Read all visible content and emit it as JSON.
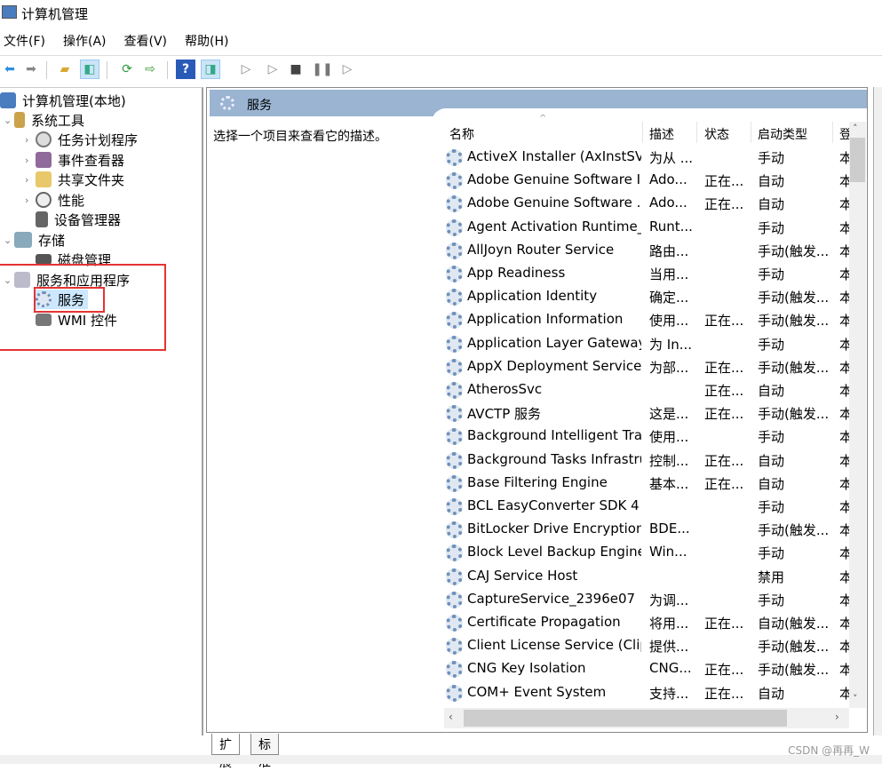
{
  "window": {
    "title": "计算机管理"
  },
  "menu": [
    "文件(F)",
    "操作(A)",
    "查看(V)",
    "帮助(H)"
  ],
  "toolbar": [
    "back-icon",
    "forward-icon",
    "up-folder-icon",
    "show-hide-tree-icon",
    "refresh-icon",
    "export-list-icon",
    "help-icon",
    "show-hide-action-pane-icon",
    "start-service-icon",
    "start-service-alt-icon",
    "stop-service-icon",
    "pause-service-icon",
    "resume-service-icon"
  ],
  "tree": [
    {
      "label": "计算机管理(本地)",
      "level": 0,
      "chev": ""
    },
    {
      "label": "系统工具",
      "level": 1,
      "chev": "⌄"
    },
    {
      "label": "任务计划程序",
      "level": 2,
      "chev": "›"
    },
    {
      "label": "事件查看器",
      "level": 2,
      "chev": "›"
    },
    {
      "label": "共享文件夹",
      "level": 2,
      "chev": "›"
    },
    {
      "label": "性能",
      "level": 2,
      "chev": "›"
    },
    {
      "label": "设备管理器",
      "level": 2,
      "chev": ""
    },
    {
      "label": "存储",
      "level": 1,
      "chev": "⌄"
    },
    {
      "label": "磁盘管理",
      "level": 2,
      "chev": ""
    },
    {
      "label": "服务和应用程序",
      "level": 1,
      "chev": "⌄"
    },
    {
      "label": "服务",
      "level": 2,
      "chev": "",
      "selected": true
    },
    {
      "label": "WMI 控件",
      "level": 2,
      "chev": ""
    }
  ],
  "pane": {
    "header": "服务",
    "description": "选择一个项目来查看它的描述。",
    "sort_indicator": "^"
  },
  "columns": [
    "名称",
    "描述",
    "状态",
    "启动类型",
    "登"
  ],
  "services": [
    [
      "ActiveX Installer (AxInstSV)",
      "为从 ...",
      "",
      "手动",
      "本"
    ],
    [
      "Adobe Genuine Software I...",
      "Ado...",
      "正在...",
      "自动",
      "本"
    ],
    [
      "Adobe Genuine Software ...",
      "Ado...",
      "正在...",
      "自动",
      "本"
    ],
    [
      "Agent Activation Runtime_...",
      "Runt...",
      "",
      "手动",
      "本"
    ],
    [
      "AllJoyn Router Service",
      "路由...",
      "",
      "手动(触发...",
      "本"
    ],
    [
      "App Readiness",
      "当用...",
      "",
      "手动",
      "本"
    ],
    [
      "Application Identity",
      "确定...",
      "",
      "手动(触发...",
      "本"
    ],
    [
      "Application Information",
      "使用...",
      "正在...",
      "手动(触发...",
      "本"
    ],
    [
      "Application Layer Gateway ...",
      "为 In...",
      "",
      "手动",
      "本"
    ],
    [
      "AppX Deployment Service ...",
      "为部...",
      "正在...",
      "手动(触发...",
      "本"
    ],
    [
      "AtherosSvc",
      "",
      "正在...",
      "自动",
      "本"
    ],
    [
      "AVCTP 服务",
      "这是...",
      "正在...",
      "手动(触发...",
      "本"
    ],
    [
      "Background Intelligent Tra...",
      "使用...",
      "",
      "手动",
      "本"
    ],
    [
      "Background Tasks Infrastru...",
      "控制...",
      "正在...",
      "自动",
      "本"
    ],
    [
      "Base Filtering Engine",
      "基本...",
      "正在...",
      "自动",
      "本"
    ],
    [
      "BCL EasyConverter SDK 4 L...",
      "",
      "",
      "手动",
      "本"
    ],
    [
      "BitLocker Drive Encryption ...",
      "BDE...",
      "",
      "手动(触发...",
      "本"
    ],
    [
      "Block Level Backup Engine ...",
      "Win...",
      "",
      "手动",
      "本"
    ],
    [
      "CAJ Service Host",
      "",
      "",
      "禁用",
      "本"
    ],
    [
      "CaptureService_2396e07",
      "为调...",
      "",
      "手动",
      "本"
    ],
    [
      "Certificate Propagation",
      "将用...",
      "正在...",
      "自动(触发...",
      "本"
    ],
    [
      "Client License Service (Clip...",
      "提供...",
      "",
      "手动(触发...",
      "本"
    ],
    [
      "CNG Key Isolation",
      "CNG...",
      "正在...",
      "手动(触发...",
      "本"
    ],
    [
      "COM+ Event System",
      "支持...",
      "正在...",
      "自动",
      "本"
    ]
  ],
  "tabs": [
    "扩展",
    "标准"
  ],
  "watermark": "CSDN @再再_W",
  "colors": {
    "header_band": "#9ab4d2",
    "selection": "#cce8ff",
    "highlight_box": "#e53333"
  }
}
